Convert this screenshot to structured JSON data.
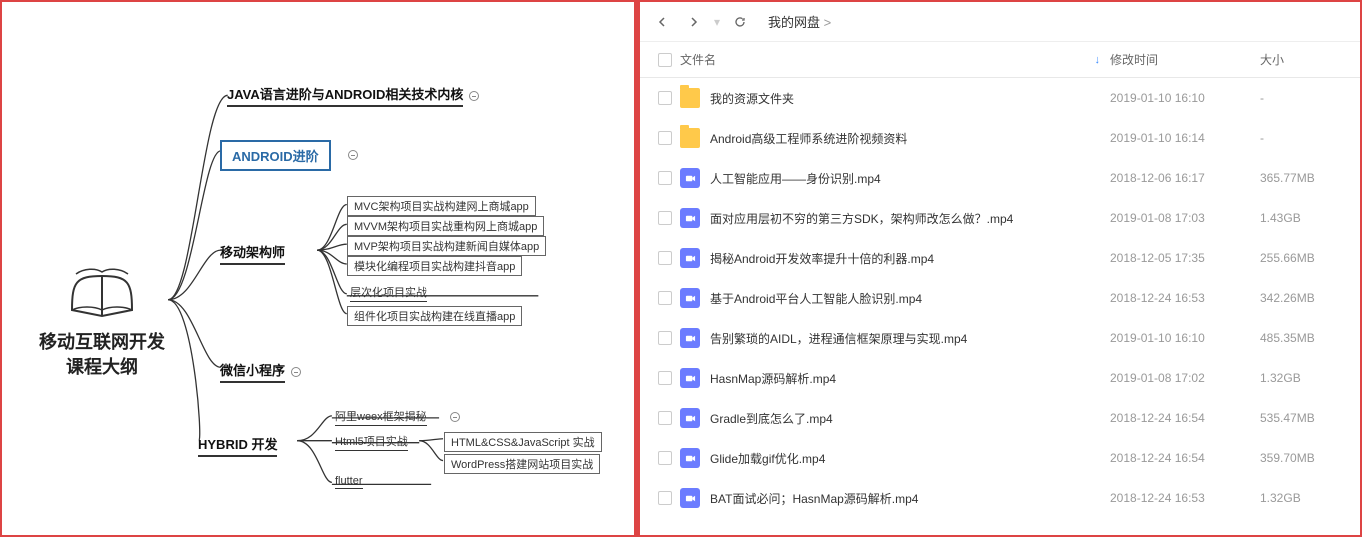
{
  "mindmap": {
    "root": "移动互联网开发课程大纲",
    "branches": {
      "java": "JAVA语言进阶与ANDROID相关技术内核",
      "android": "ANDROID进阶",
      "arch": "移动架构师",
      "wechat": "微信小程序",
      "hybrid": "HYBRID 开发"
    },
    "arch_leaves": [
      "MVC架构项目实战构建网上商城app",
      "MVVM架构项目实战重构网上商城app",
      "MVP架构项目实战构建新闻自媒体app",
      "模块化编程项目实战构建抖音app",
      "层次化项目实战",
      "组件化项目实战构建在线直播app"
    ],
    "hybrid_leaves": {
      "weex": "阿里weex框架揭秘",
      "html5": "Html5项目实战",
      "flutter": "flutter",
      "html5_sub": [
        "HTML&CSS&JavaScript 实战",
        "WordPress搭建网站项目实战"
      ]
    }
  },
  "browser": {
    "breadcrumb": "我的网盘",
    "breadcrumb_sep": ">",
    "headers": {
      "name": "文件名",
      "date": "修改时间",
      "size": "大小"
    },
    "files": [
      {
        "type": "folder",
        "name": "我的资源文件夹",
        "date": "2019-01-10 16:10",
        "size": "-"
      },
      {
        "type": "folder",
        "name": "Android高级工程师系统进阶视频资料",
        "date": "2019-01-10 16:14",
        "size": "-"
      },
      {
        "type": "video",
        "name": "人工智能应用——身份识别.mp4",
        "date": "2018-12-06 16:17",
        "size": "365.77MB"
      },
      {
        "type": "video",
        "name": "面对应用层初不穷的第三方SDK，架构师改怎么做？.mp4",
        "date": "2019-01-08 17:03",
        "size": "1.43GB"
      },
      {
        "type": "video",
        "name": "揭秘Android开发效率提升十倍的利器.mp4",
        "date": "2018-12-05 17:35",
        "size": "255.66MB"
      },
      {
        "type": "video",
        "name": "基于Android平台人工智能人脸识别.mp4",
        "date": "2018-12-24 16:53",
        "size": "342.26MB"
      },
      {
        "type": "video",
        "name": "告别繁琐的AIDL，进程通信框架原理与实现.mp4",
        "date": "2019-01-10 16:10",
        "size": "485.35MB"
      },
      {
        "type": "video",
        "name": "HasnMap源码解析.mp4",
        "date": "2019-01-08 17:02",
        "size": "1.32GB"
      },
      {
        "type": "video",
        "name": "Gradle到底怎么了.mp4",
        "date": "2018-12-24 16:54",
        "size": "535.47MB"
      },
      {
        "type": "video",
        "name": "Glide加载gif优化.mp4",
        "date": "2018-12-24 16:54",
        "size": "359.70MB"
      },
      {
        "type": "video",
        "name": "BAT面试必问；HasnMap源码解析.mp4",
        "date": "2018-12-24 16:53",
        "size": "1.32GB"
      }
    ]
  }
}
